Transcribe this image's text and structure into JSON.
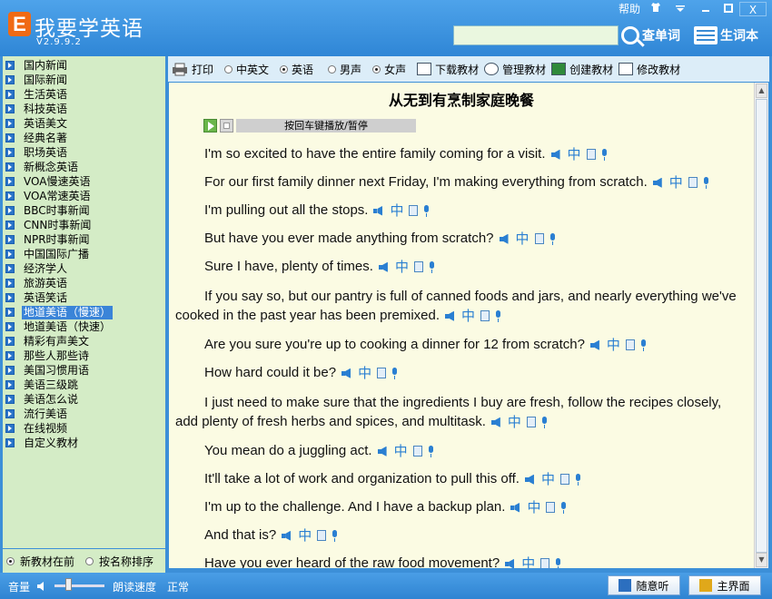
{
  "app": {
    "logo_letter": "E",
    "title": "我要学英语",
    "version": "V2.9.9.2",
    "window": {
      "help": "帮助",
      "close": "X"
    },
    "search_placeholder": "",
    "lookup_label": "查单词",
    "vocab_label": "生词本"
  },
  "sidebar": {
    "items": [
      "国内新闻",
      "国际新闻",
      "生活英语",
      "科技英语",
      "英语美文",
      "经典名著",
      "职场英语",
      "新概念英语",
      "VOA慢速英语",
      "VOA常速英语",
      "BBC时事新闻",
      "CNN时事新闻",
      "NPR时事新闻",
      "中国国际广播",
      "经济学人",
      "旅游英语",
      "英语笑话",
      "地道美语（慢速）",
      "地道美语（快速）",
      "精彩有声美文",
      "那些人那些诗",
      "美国习惯用语",
      "美语三级跳",
      "美语怎么说",
      "流行美语",
      "在线视频",
      "自定义教材"
    ],
    "selected_index": 17,
    "sort_new_first": "新教材在前",
    "sort_by_name": "按名称排序"
  },
  "toolbar": {
    "print": "打印",
    "opt_cn_en": "中英文",
    "opt_en": "英语",
    "opt_male": "男声",
    "opt_female": "女声",
    "download": "下载教材",
    "manage": "管理教材",
    "create": "创建教材",
    "edit": "修改教材"
  },
  "document": {
    "title": "从无到有烹制家庭晚餐",
    "play_hint": "按回车键播放/暂停",
    "zh_mark": "中",
    "lines": [
      "I'm so excited to have the entire family coming for a visit.",
      "For our first family dinner next Friday, I'm making everything from scratch.",
      "I'm pulling out all the stops.",
      "But have you ever made anything from scratch?",
      "Sure I have, plenty of times.",
      "If you say so, but our pantry is full of canned foods and jars, and nearly everything we've cooked in the past year has been premixed.",
      "Are you sure you're up to cooking a dinner for 12 from scratch?",
      "How hard could it be?",
      "I just need to make sure that the ingredients I buy are fresh, follow the recipes closely, add plenty of fresh herbs and spices, and multitask.",
      "You mean do a juggling act.",
      "It'll take a lot of work and organization to pull this off.",
      "I'm up to the challenge. And I have a backup plan.",
      "And that is?",
      "Have you ever heard of the raw food movement?"
    ]
  },
  "statusbar": {
    "volume": "音量",
    "speed_label": "朗读速度",
    "speed_value": "正常",
    "random_listen": "随意听",
    "main_screen": "主界面"
  }
}
